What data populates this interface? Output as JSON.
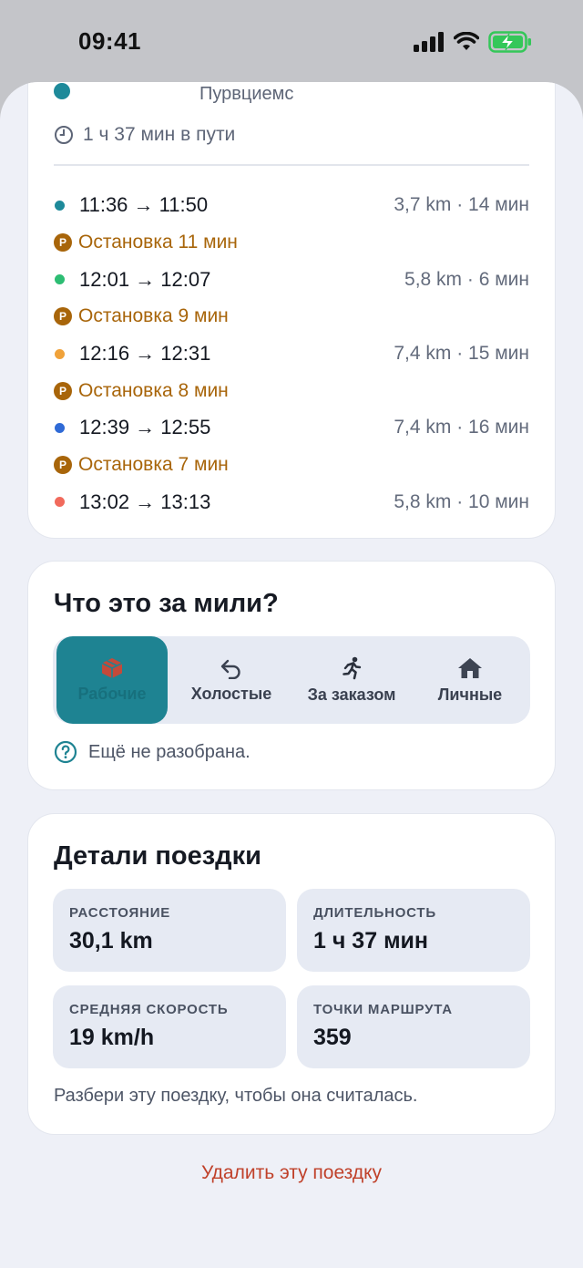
{
  "status_bar": {
    "time": "09:41"
  },
  "route": {
    "origin_name": "Пурвциемс",
    "duration": "1 ч 37 мин в пути",
    "rows": [
      {
        "kind": "segment",
        "color": "#1e8a9a",
        "time": "11:36 → 11:50",
        "meta": "3,7 km · 14 мин"
      },
      {
        "kind": "stop",
        "badge": "P",
        "label": "Остановка 11 мин"
      },
      {
        "kind": "segment",
        "color": "#2dbd73",
        "time": "12:01 → 12:07",
        "meta": "5,8 km · 6 мин"
      },
      {
        "kind": "stop",
        "badge": "P",
        "label": "Остановка 9 мин"
      },
      {
        "kind": "segment",
        "color": "#f0a23a",
        "time": "12:16 → 12:31",
        "meta": "7,4 km · 15 мин"
      },
      {
        "kind": "stop",
        "badge": "P",
        "label": "Остановка 8 мин"
      },
      {
        "kind": "segment",
        "color": "#2f6ad6",
        "time": "12:39 → 12:55",
        "meta": "7,4 km · 16 мин"
      },
      {
        "kind": "stop",
        "badge": "P",
        "label": "Остановка 7 мин"
      },
      {
        "kind": "segment",
        "color": "#f16a5c",
        "time": "13:02 → 13:13",
        "meta": "5,8 km · 10 мин"
      }
    ]
  },
  "miles": {
    "title": "Что это за мили?",
    "options": [
      {
        "label": "Рабочие",
        "icon": "briefcase-icon",
        "selected": true
      },
      {
        "label": "Холостые",
        "icon": "undo-arrow-icon",
        "selected": false
      },
      {
        "label": "За заказом",
        "icon": "running-person-icon",
        "selected": false
      },
      {
        "label": "Личные",
        "icon": "home-icon",
        "selected": false
      }
    ],
    "status": "Ещё не разобрана."
  },
  "details": {
    "title": "Детали поездки",
    "tiles": [
      {
        "label": "РАССТОЯНИЕ",
        "value": "30,1 km"
      },
      {
        "label": "ДЛИТЕЛЬНОСТЬ",
        "value": "1 ч 37 мин"
      },
      {
        "label": "СРЕДНЯЯ СКОРОСТЬ",
        "value": "19 km/h"
      },
      {
        "label": "ТОЧКИ МАРШРУТА",
        "value": "359"
      }
    ],
    "hint": "Разбери эту поездку, чтобы она считалась."
  },
  "delete_label": "Удалить эту поездку",
  "colors": {
    "accent": "#1e8392",
    "stop": "#a8650a",
    "danger": "#c0412a"
  }
}
